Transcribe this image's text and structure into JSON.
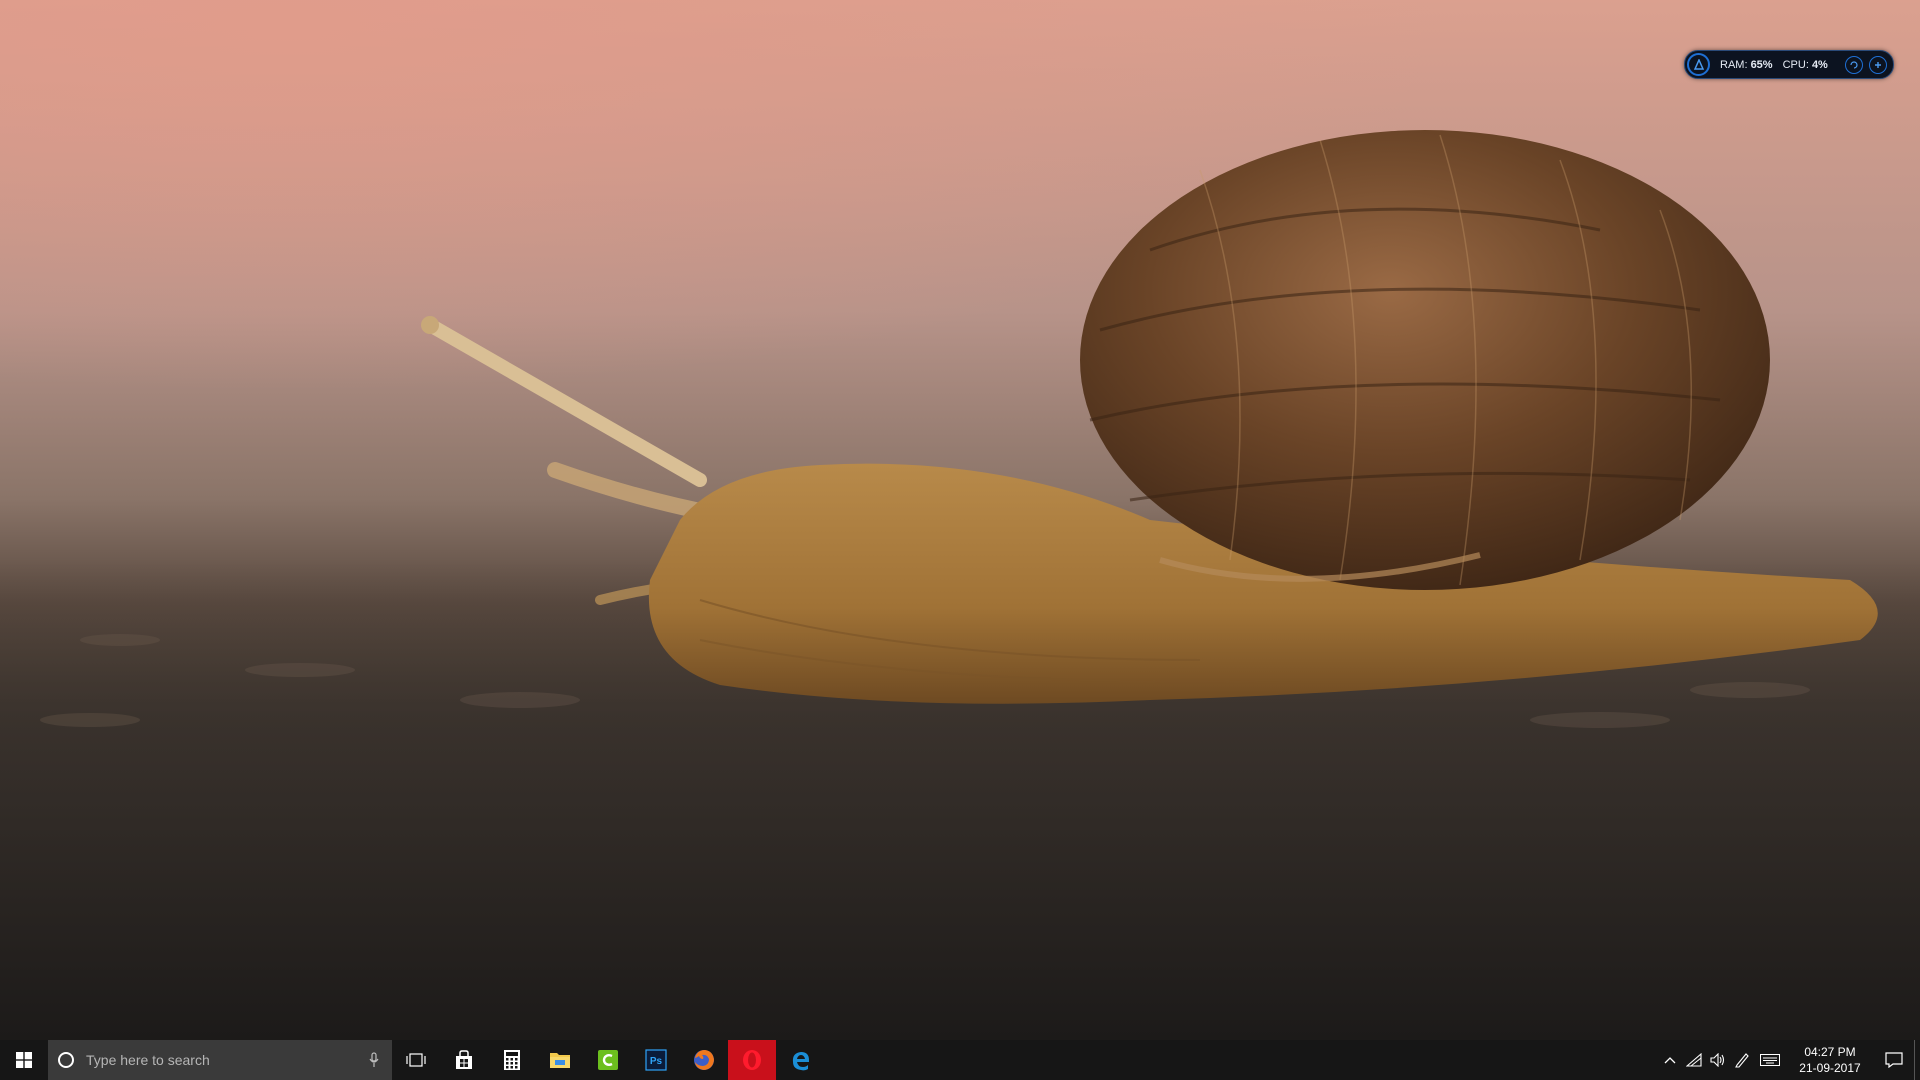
{
  "sysmon": {
    "ram_label": "RAM:",
    "ram_value": "65%",
    "cpu_label": "CPU:",
    "cpu_value": "4%"
  },
  "taskbar": {
    "search_placeholder": "Type here to search",
    "pinned": [
      "task-view",
      "store",
      "calculator",
      "file-explorer",
      "camtasia",
      "photoshop",
      "firefox",
      "opera",
      "edge"
    ],
    "photoshop_label": "Ps",
    "clock_time": "04:27 PM",
    "clock_date": "21-09-2017"
  },
  "colors": {
    "taskbar": "#161616",
    "search_box": "#3a3a3a",
    "opera_active": "#c9101b",
    "widget_accent": "#1e6fd4"
  }
}
